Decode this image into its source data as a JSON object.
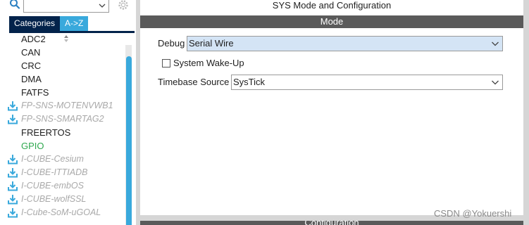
{
  "search": {
    "value": ""
  },
  "tabs": [
    {
      "label": "Categories"
    },
    {
      "label": "A->Z"
    }
  ],
  "tree": {
    "items": [
      {
        "label": "ADC2",
        "state": "normal",
        "download": false
      },
      {
        "label": "CAN",
        "state": "normal",
        "download": false
      },
      {
        "label": "CRC",
        "state": "normal",
        "download": false
      },
      {
        "label": "DMA",
        "state": "normal",
        "download": false
      },
      {
        "label": "FATFS",
        "state": "normal",
        "download": false
      },
      {
        "label": "FP-SNS-MOTENVWB1",
        "state": "disabled",
        "download": true
      },
      {
        "label": "FP-SNS-SMARTAG2",
        "state": "disabled",
        "download": true
      },
      {
        "label": "FREERTOS",
        "state": "normal",
        "download": false
      },
      {
        "label": "GPIO",
        "state": "active",
        "download": false
      },
      {
        "label": "I-CUBE-Cesium",
        "state": "disabled",
        "download": true
      },
      {
        "label": "I-CUBE-ITTIADB",
        "state": "disabled",
        "download": true
      },
      {
        "label": "I-CUBE-embOS",
        "state": "disabled",
        "download": true
      },
      {
        "label": "I-CUBE-wolfSSL",
        "state": "disabled",
        "download": true
      },
      {
        "label": "I-Cube-SoM-uGOAL",
        "state": "disabled",
        "download": true
      }
    ],
    "colors": {
      "normal": "#1e1e1e",
      "disabled": "#a9a9a9",
      "active": "#2fa84f",
      "download_icon": "#39a9dc"
    }
  },
  "main": {
    "title": "SYS Mode and Configuration",
    "mode_header": "Mode",
    "debug": {
      "label": "Debug",
      "value": "Serial Wire"
    },
    "wakeup": {
      "label": "System Wake-Up",
      "checked": false
    },
    "timebase": {
      "label": "Timebase Source",
      "value": "SysTick"
    },
    "config_header": "Configuration"
  },
  "watermark": "CSDN @Yokuershi",
  "colors": {
    "accent": "#39a9dc",
    "tab_dark": "#03234b",
    "bar": "#5a5a5a"
  }
}
